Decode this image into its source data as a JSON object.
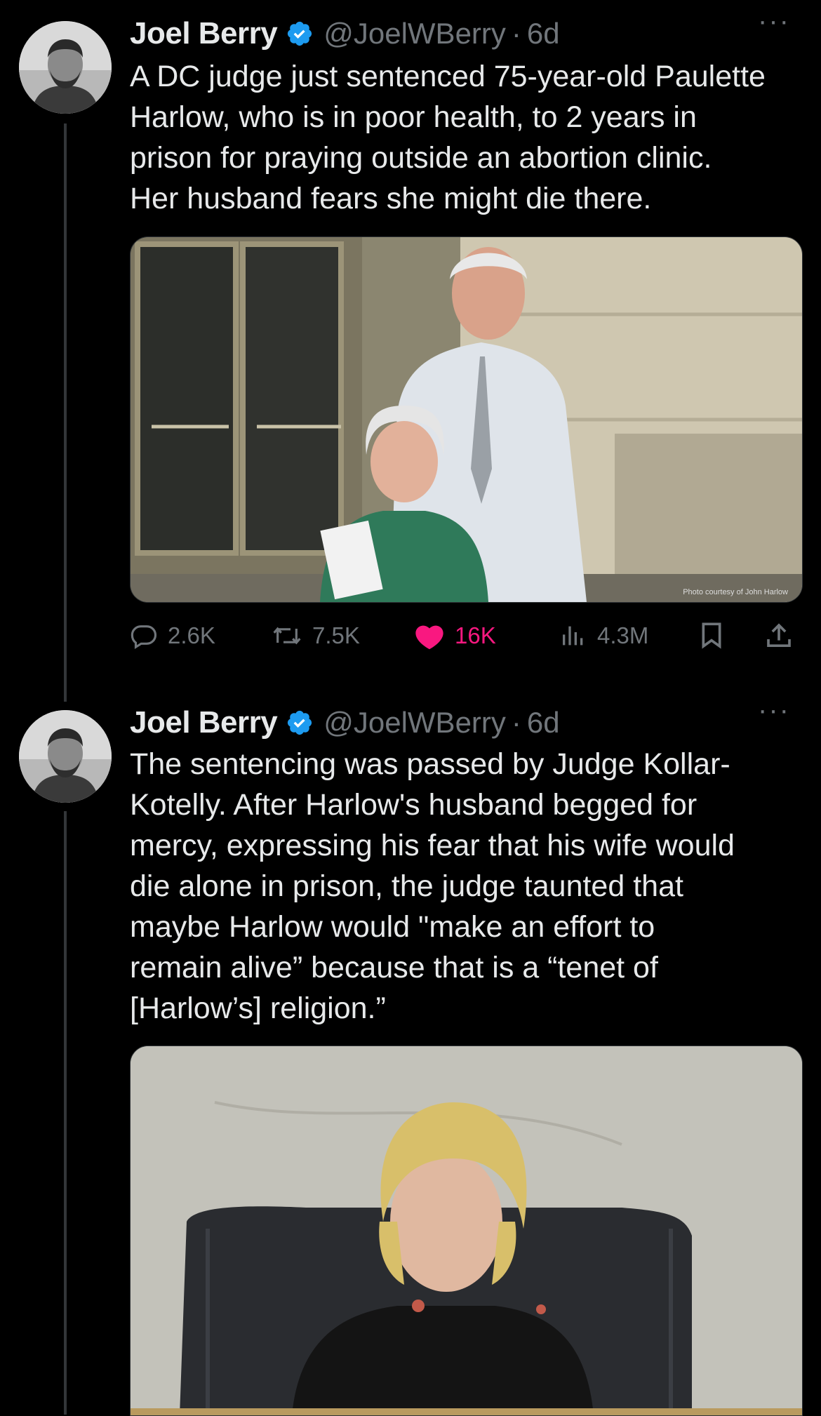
{
  "tweets": [
    {
      "author_name": "Joel Berry",
      "handle": "@JoelWBerry",
      "separator": "·",
      "time": "6d",
      "more_label": "···",
      "text_lines": [
        "A DC judge just sentenced 75-year-old Paulette",
        "Harlow, who is in poor health, to 2 years in",
        "prison for praying outside an abortion clinic.",
        "Her husband fears she might die there."
      ],
      "media_caption": "Photo courtesy of John Harlow",
      "actions": {
        "replies": "2.6K",
        "reposts": "7.5K",
        "likes": "16K",
        "views": "4.3M"
      }
    },
    {
      "author_name": "Joel Berry",
      "handle": "@JoelWBerry",
      "separator": "·",
      "time": "6d",
      "more_label": "···",
      "text_lines": [
        "The sentencing was passed by Judge Kollar-",
        "Kotelly. After Harlow's husband begged for",
        "mercy, expressing his fear that his wife would",
        "die alone in prison, the judge taunted that",
        "maybe Harlow would \"make an effort to",
        "remain alive” because that is a “tenet of",
        "[Harlow’s] religion.”"
      ]
    }
  ],
  "colors": {
    "background": "#000000",
    "text_primary": "#e7e9ea",
    "text_secondary": "#71767b",
    "verified_blue": "#1d9bf0",
    "like_pink": "#f91880"
  },
  "icons": [
    "verified-badge-icon",
    "reply-icon",
    "repost-icon",
    "heart-icon",
    "views-icon",
    "bookmark-icon",
    "share-icon"
  ]
}
